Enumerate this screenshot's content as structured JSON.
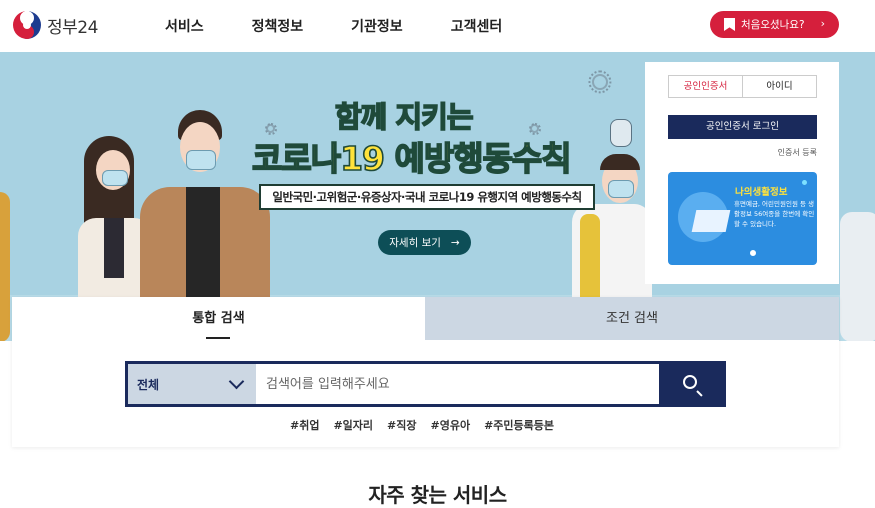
{
  "header": {
    "logo_text": "정부24",
    "nav": [
      "서비스",
      "정책정보",
      "기관정보",
      "고객센터"
    ],
    "first_visit_label": "처음오셨나요?",
    "first_visit_arrow": "›"
  },
  "banner": {
    "title_line1": "함께 지키는",
    "title_line2": "코로나19 예방행동수칙",
    "subtitle": "일반국민·고위험군·유증상자·국내 코로나19 유행지역 예방행동수칙",
    "more_button": "자세히 보기",
    "more_arrow": "→"
  },
  "login": {
    "tabs": [
      "공인인증서",
      "아이디"
    ],
    "login_button": "공인인증서 로그인",
    "cert_register": "인증서 등록",
    "promo_title": "나의생활정보",
    "promo_text": "휴면예금, 어린민원인원 등 생활정보 56여종을 한번에 확인할 수 있습니다."
  },
  "search": {
    "tabs": [
      "통합 검색",
      "조건 검색"
    ],
    "category": "전체",
    "placeholder": "검색어를 입력해주세요",
    "tags": [
      "#취업",
      "#일자리",
      "#직장",
      "#영유아",
      "#주민등록등본"
    ]
  },
  "section": {
    "title": "자주 찾는 서비스"
  },
  "colors": {
    "accent_red": "#d51f3c",
    "navy": "#1a2a5c",
    "banner_bg": "#a8d2e2",
    "headline_yellow": "#ffe23b"
  }
}
